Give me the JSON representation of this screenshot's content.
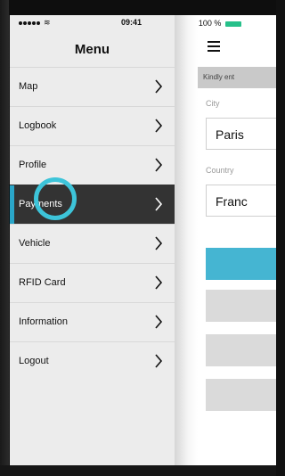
{
  "status": {
    "time": "09:41",
    "battery": "100 %"
  },
  "menu": {
    "title": "Menu",
    "items": [
      {
        "label": "Map",
        "active": false
      },
      {
        "label": "Logbook",
        "active": false
      },
      {
        "label": "Profile",
        "active": false
      },
      {
        "label": "Payments",
        "active": true
      },
      {
        "label": "Vehicle",
        "active": false
      },
      {
        "label": "RFID Card",
        "active": false
      },
      {
        "label": "Information",
        "active": false
      },
      {
        "label": "Logout",
        "active": false
      }
    ]
  },
  "form": {
    "banner_text": "Kindly ent",
    "city_label": "City",
    "city_value": "Paris",
    "country_label": "Country",
    "country_value": "Franc"
  },
  "colors": {
    "accent": "#2aa6c9",
    "active_row": "#333333",
    "primary_button": "#45b5d2",
    "battery": "#26c08a"
  },
  "icons": {
    "menu": "hamburger-icon",
    "chevron": "chevron-right-icon",
    "location": "location-arrow-icon",
    "bluetooth": "bluetooth-icon",
    "wifi": "wifi-icon",
    "battery": "battery-icon"
  }
}
